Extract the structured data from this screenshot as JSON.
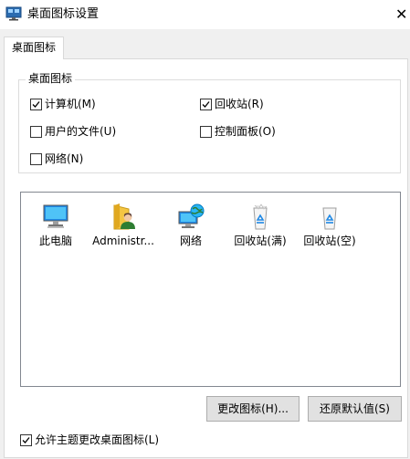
{
  "window": {
    "title": "桌面图标设置",
    "close_glyph": "✕"
  },
  "tabs": [
    {
      "label": "桌面图标",
      "selected": true
    }
  ],
  "desktop_icons_group": {
    "title": "桌面图标",
    "checkboxes": [
      {
        "label": "计算机(M)",
        "checked": true
      },
      {
        "label": "回收站(R)",
        "checked": true
      },
      {
        "label": "用户的文件(U)",
        "checked": false
      },
      {
        "label": "控制面板(O)",
        "checked": false
      },
      {
        "label": "网络(N)",
        "checked": false
      }
    ]
  },
  "icon_list": {
    "items": [
      {
        "label": "此电脑",
        "icon": "computer-icon"
      },
      {
        "label": "Administr...",
        "icon": "user-folder-icon"
      },
      {
        "label": "网络",
        "icon": "network-icon"
      },
      {
        "label": "回收站(满)",
        "icon": "recycle-bin-full-icon"
      },
      {
        "label": "回收站(空)",
        "icon": "recycle-bin-empty-icon"
      }
    ]
  },
  "buttons": {
    "change_icon": "更改图标(H)...",
    "restore_default": "还原默认值(S)"
  },
  "allow_themes_checkbox": {
    "label": "允许主题更改桌面图标(L)",
    "checked": true
  },
  "colors": {
    "window_bg": "#f0f0f0",
    "panel_bg": "#ffffff",
    "button_bg": "#e1e1e1",
    "accent_blue": "#0078d7"
  }
}
